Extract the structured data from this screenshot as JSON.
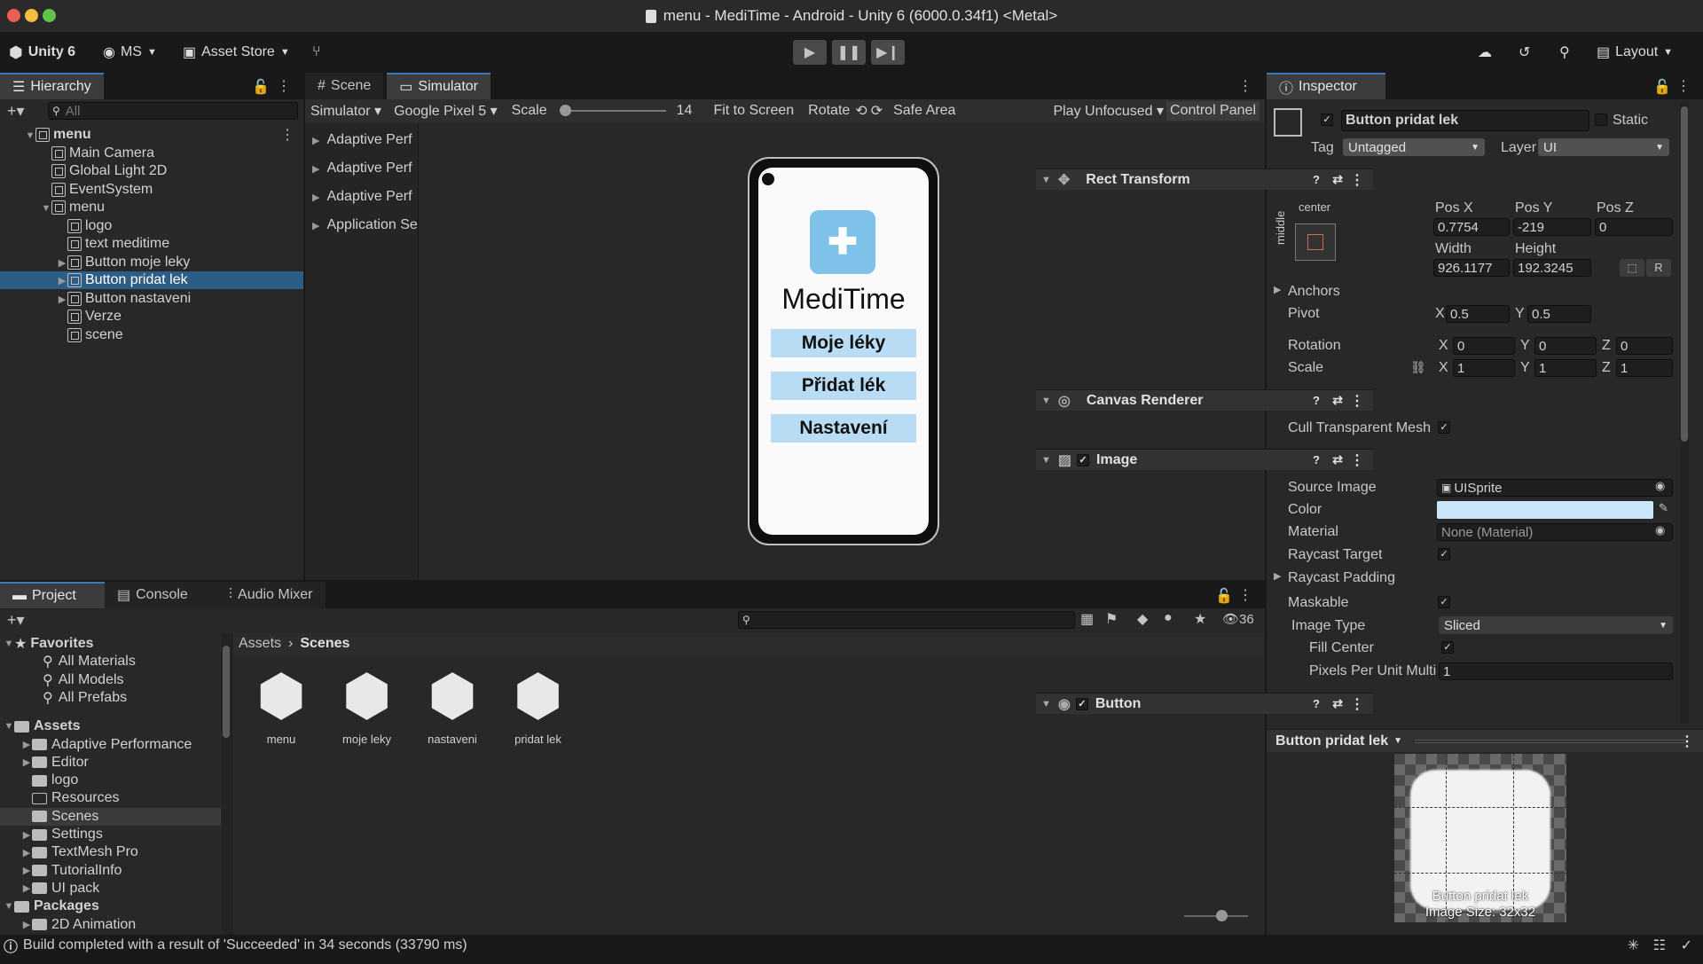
{
  "window": {
    "title": "menu - MediTime - Android - Unity 6 (6000.0.34f1) <Metal>"
  },
  "toolbar": {
    "unity_label": "Unity 6",
    "account": "MS",
    "asset_store": "Asset Store",
    "layout": "Layout"
  },
  "hierarchy": {
    "tab": "Hierarchy",
    "search_placeholder": "All",
    "items": [
      {
        "label": "menu",
        "indent": 0,
        "arrow": "▼",
        "bold": true
      },
      {
        "label": "Main Camera",
        "indent": 1,
        "arrow": ""
      },
      {
        "label": "Global Light 2D",
        "indent": 1,
        "arrow": ""
      },
      {
        "label": "EventSystem",
        "indent": 1,
        "arrow": ""
      },
      {
        "label": "menu",
        "indent": 1,
        "arrow": "▼"
      },
      {
        "label": "logo",
        "indent": 2,
        "arrow": ""
      },
      {
        "label": "text meditime",
        "indent": 2,
        "arrow": ""
      },
      {
        "label": "Button moje leky",
        "indent": 2,
        "arrow": "▶"
      },
      {
        "label": "Button pridat lek",
        "indent": 2,
        "arrow": "▶",
        "selected": true
      },
      {
        "label": "Button nastaveni",
        "indent": 2,
        "arrow": "▶"
      },
      {
        "label": "Verze",
        "indent": 2,
        "arrow": ""
      },
      {
        "label": "scene",
        "indent": 2,
        "arrow": ""
      }
    ]
  },
  "center": {
    "tabs": [
      "Scene",
      "Simulator"
    ],
    "sim_toolbar": {
      "simulator": "Simulator",
      "device": "Google Pixel 5",
      "scale_label": "Scale",
      "scale_value": "14",
      "fit": "Fit to Screen",
      "rotate": "Rotate",
      "safe_area": "Safe Area",
      "play_unfocused": "Play Unfocused",
      "control_panel": "Control Panel"
    },
    "side_list": [
      "Adaptive Perf",
      "Adaptive Perf",
      "Adaptive Perf",
      "Application Se"
    ],
    "phone": {
      "app_title": "MediTime",
      "buttons": [
        "Moje léky",
        "Přidat lék",
        "Nastavení"
      ]
    }
  },
  "project": {
    "tabs": [
      "Project",
      "Console",
      "Audio Mixer"
    ],
    "count": "36",
    "favorites_label": "Favorites",
    "favorites": [
      "All Materials",
      "All Models",
      "All Prefabs"
    ],
    "assets_label": "Assets",
    "assets": [
      {
        "label": "Adaptive Performance",
        "arrow": "▶"
      },
      {
        "label": "Editor",
        "arrow": "▶"
      },
      {
        "label": "logo",
        "arrow": ""
      },
      {
        "label": "Resources",
        "arrow": "",
        "empty": true
      },
      {
        "label": "Scenes",
        "arrow": "",
        "selected": true
      },
      {
        "label": "Settings",
        "arrow": "▶"
      },
      {
        "label": "TextMesh Pro",
        "arrow": "▶"
      },
      {
        "label": "TutorialInfo",
        "arrow": "▶"
      },
      {
        "label": "UI pack",
        "arrow": "▶"
      }
    ],
    "packages_label": "Packages",
    "packages": [
      "2D Animation"
    ],
    "breadcrumb": [
      "Assets",
      "Scenes"
    ],
    "files": [
      "menu",
      "moje leky",
      "nastaveni",
      "pridat lek"
    ]
  },
  "inspector": {
    "tab": "Inspector",
    "object_name": "Button pridat lek",
    "static": "Static",
    "tag_label": "Tag",
    "tag": "Untagged",
    "layer_label": "Layer",
    "layer": "UI",
    "rect": {
      "title": "Rect Transform",
      "anchor_h": "center",
      "anchor_v": "middle",
      "posx_label": "Pos X",
      "posy_label": "Pos Y",
      "posz_label": "Pos Z",
      "posx": "0.7754",
      "posy": "-219",
      "posz": "0",
      "width_label": "Width",
      "height_label": "Height",
      "width": "926.1177",
      "height": "192.3245",
      "r": "R",
      "anchors": "Anchors",
      "pivot": "Pivot",
      "pivot_x": "0.5",
      "pivot_y": "0.5",
      "rotation": "Rotation",
      "rot_x": "0",
      "rot_y": "0",
      "rot_z": "0",
      "scale": "Scale",
      "scale_x": "1",
      "scale_y": "1",
      "scale_z": "1"
    },
    "canvas_renderer": {
      "title": "Canvas Renderer",
      "cull": "Cull Transparent Mesh"
    },
    "image": {
      "title": "Image",
      "source_label": "Source Image",
      "source": "UISprite",
      "color_label": "Color",
      "color_value": "#c9e7f8",
      "material_label": "Material",
      "material": "None (Material)",
      "raycast_target": "Raycast Target",
      "raycast_padding": "Raycast Padding",
      "maskable": "Maskable",
      "image_type_label": "Image Type",
      "image_type": "Sliced",
      "fill_center": "Fill Center",
      "ppu_label": "Pixels Per Unit Multi",
      "ppu": "1"
    },
    "button": {
      "title": "Button"
    },
    "preview": {
      "title": "Button pridat lek",
      "caption1": "Button pridat lek",
      "caption2": "Image Size: 32x32"
    }
  },
  "status": {
    "message": "Build completed with a result of 'Succeeded' in 34 seconds (33790 ms)"
  },
  "colors": {
    "accent": "#3a79bb",
    "selected_row": "#2c5d87",
    "button_fill": "#b8dcf3",
    "app_icon": "#7ec2ea"
  }
}
